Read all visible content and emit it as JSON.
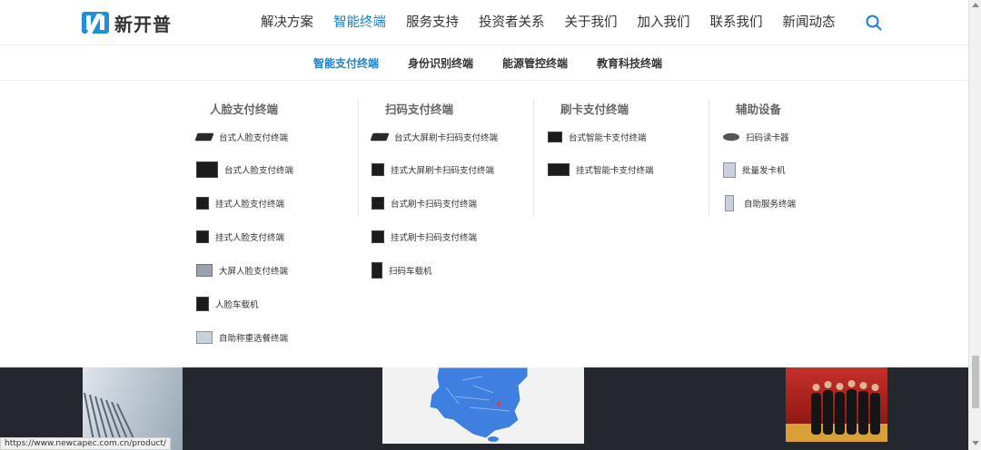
{
  "brand": {
    "name": "新开普",
    "accent": "#1e7fd0"
  },
  "nav": {
    "items": [
      "解决方案",
      "智能终端",
      "服务支持",
      "投资者关系",
      "关于我们",
      "加入我们",
      "联系我们",
      "新闻动态"
    ],
    "active_index": 1,
    "search_icon": "search-icon"
  },
  "subnav": {
    "items": [
      "智能支付终端",
      "身份识别终端",
      "能源管控终端",
      "教育科技终端"
    ],
    "active_index": 0
  },
  "menu": {
    "columns": [
      {
        "title": "人脸支付终端",
        "items": [
          "台式人脸支付终端",
          "台式人脸支付终端",
          "挂式人脸支付终端",
          "挂式人脸支付终端",
          "大屏人脸支付终端",
          "人脸车载机",
          "自助称重选餐终端"
        ]
      },
      {
        "title": "扫码支付终端",
        "items": [
          "台式大屏刷卡扫码支付终端",
          "挂式大屏刷卡扫码支付终端",
          "台式刷卡扫码支付终端",
          "挂式刷卡扫码支付终端",
          "扫码车载机"
        ]
      },
      {
        "title": "刷卡支付终端",
        "items": [
          "台式智能卡支付终端",
          "挂式智能卡支付终端"
        ]
      },
      {
        "title": "辅助设备",
        "items": [
          "扫码读卡器",
          "批量发卡机",
          "自助服务终端"
        ]
      }
    ]
  },
  "status_bar": {
    "url": "https://www.newcapec.com.cn/product/"
  }
}
